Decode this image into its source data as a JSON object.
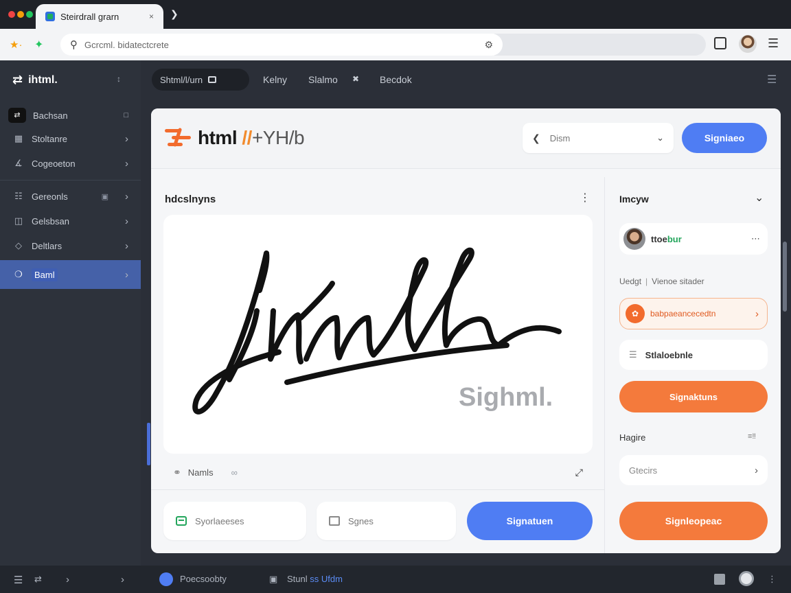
{
  "browser": {
    "tab_title": "Steirdrall grarn",
    "tab_close": "×",
    "address_text": "Gcrcml. bidatectcrete"
  },
  "sidebar": {
    "brand": "ihtml.",
    "items": [
      {
        "label": "Bachsan",
        "icon": "box-icon"
      },
      {
        "label": "Stoltanre",
        "icon": "layout-icon"
      },
      {
        "label": "Cogeoeton",
        "icon": "chart-icon"
      },
      {
        "label": "Gereonls",
        "icon": "grid-icon"
      },
      {
        "label": "Gelsbsan",
        "icon": "storage-icon"
      },
      {
        "label": "Deltlars",
        "icon": "diamond-icon"
      },
      {
        "label": "Baml",
        "icon": "badge-icon"
      }
    ]
  },
  "topnav": {
    "pill": "Shtml/l/urn",
    "links": [
      "Kelny",
      "Slalmo",
      "Becdok"
    ]
  },
  "card": {
    "brand_main": "html",
    "brand_accent": "//",
    "brand_rest": "+YH/b",
    "select_value": "Dism",
    "signin_button": "Signiaeo",
    "panel_title": "hdcslnyns",
    "signature_caption": "Sighml.",
    "toolbar_label": "Namls",
    "field1": "Syorlaeeses",
    "field2": "Sgnes",
    "submit_button": "Signatuen"
  },
  "right": {
    "title": "Imcyw",
    "user_name_a": "ttoe",
    "user_name_b": "bur",
    "meta_a": "Uedgt",
    "meta_b": "Vienoe sitader",
    "orange_row": "babpaeancecedtn",
    "plain_row": "Stlaloebnle",
    "orange_button": "Signaktuns",
    "subheading": "Hagire",
    "select_value": "Gtecirs",
    "big_button": "Signleopeac"
  },
  "bottombar": {
    "left_label": "Poecsoobty",
    "mid_label_a": "Stunl",
    "mid_label_b": "ss Ufdm"
  },
  "colors": {
    "accent_blue": "#4f7df3",
    "accent_orange": "#f47a3c",
    "sidebar_bg": "#2d323b",
    "sidebar_active": "#4561a8"
  }
}
